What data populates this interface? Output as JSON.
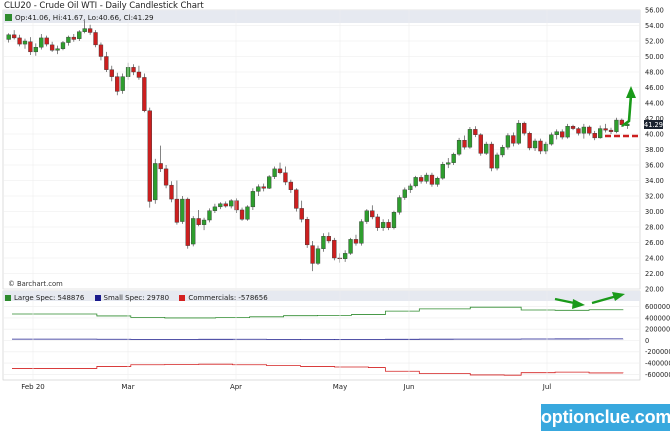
{
  "title": "CLU20 - Crude Oil WTI - Daily Candlestick Chart",
  "ohlc_text": "Op:41.06, Hi:41.67, Lo:40.66, Cl:41.29",
  "credit": "© Barchart.com",
  "last_price_label": "41.29",
  "brand": "optionclue.com",
  "cot_legend": [
    {
      "label": "Large Spec: 548876",
      "color": "#2e8b2e"
    },
    {
      "label": "Small Spec: 29780",
      "color": "#1a1a8c"
    },
    {
      "label": "Commercials: -578656",
      "color": "#d42020"
    }
  ],
  "colors": {
    "up": "#2e9e2e",
    "down": "#cc1f1f",
    "accent": "#1a9a1a",
    "dash": "#cc1f1f"
  },
  "chart_data": [
    {
      "type": "candlestick",
      "title": "CLU20 - Crude Oil WTI - Daily Candlestick Chart",
      "ylim": [
        20,
        56
      ],
      "yticks": [
        "20.00",
        "22.00",
        "24.00",
        "26.00",
        "28.00",
        "30.00",
        "32.00",
        "34.00",
        "36.00",
        "38.00",
        "40.00",
        "42.00",
        "44.00",
        "46.00",
        "48.00",
        "50.00",
        "52.00",
        "54.00",
        "56.00"
      ],
      "xticks": [
        "Feb 20",
        "Mar",
        "Apr",
        "May",
        "Jun",
        "Jul"
      ],
      "series": [
        {
          "values": [
            [
              52.2,
              53.0,
              51.8,
              52.8
            ],
            [
              52.8,
              53.4,
              52.2,
              52.4
            ],
            [
              52.4,
              52.8,
              51.3,
              51.6
            ],
            [
              51.6,
              52.3,
              51.0,
              52.0
            ],
            [
              51.9,
              52.5,
              50.2,
              50.6
            ],
            [
              50.6,
              51.7,
              50.1,
              51.2
            ],
            [
              51.2,
              52.9,
              50.9,
              52.4
            ],
            [
              52.4,
              52.7,
              51.3,
              51.6
            ],
            [
              51.5,
              51.9,
              50.6,
              50.8
            ],
            [
              50.8,
              51.4,
              50.3,
              51.0
            ],
            [
              51.0,
              52.0,
              50.8,
              51.8
            ],
            [
              51.8,
              52.7,
              51.4,
              52.5
            ],
            [
              52.5,
              52.9,
              51.9,
              52.2
            ],
            [
              52.3,
              53.4,
              52.0,
              53.2
            ],
            [
              53.2,
              54.6,
              53.0,
              53.6
            ],
            [
              53.6,
              54.1,
              52.8,
              53.1
            ],
            [
              53.1,
              53.4,
              51.2,
              51.5
            ],
            [
              51.5,
              51.8,
              49.5,
              50.0
            ],
            [
              50.0,
              50.6,
              48.0,
              48.3
            ],
            [
              48.3,
              48.8,
              46.8,
              47.4
            ],
            [
              47.4,
              47.9,
              45.0,
              45.5
            ],
            [
              45.6,
              47.8,
              45.2,
              47.4
            ],
            [
              47.4,
              49.2,
              47.0,
              48.6
            ],
            [
              48.6,
              49.0,
              47.6,
              48.0
            ],
            [
              48.0,
              48.8,
              47.0,
              47.3
            ],
            [
              47.3,
              47.8,
              42.8,
              43.0
            ],
            [
              43.0,
              43.4,
              30.5,
              31.3
            ],
            [
              31.5,
              36.8,
              31.0,
              36.2
            ],
            [
              36.2,
              38.5,
              35.1,
              35.5
            ],
            [
              35.5,
              36.0,
              33.0,
              33.4
            ],
            [
              33.4,
              33.9,
              31.2,
              31.6
            ],
            [
              31.6,
              34.0,
              28.3,
              28.6
            ],
            [
              28.7,
              32.0,
              28.4,
              31.6
            ],
            [
              31.6,
              31.8,
              25.2,
              25.6
            ],
            [
              25.8,
              29.4,
              25.5,
              29.1
            ],
            [
              29.1,
              30.2,
              28.1,
              28.3
            ],
            [
              28.3,
              29.2,
              27.6,
              28.9
            ],
            [
              28.9,
              30.4,
              28.6,
              30.1
            ],
            [
              30.1,
              31.0,
              29.8,
              30.6
            ],
            [
              30.6,
              31.2,
              30.3,
              31.0
            ],
            [
              31.0,
              31.3,
              30.5,
              30.7
            ],
            [
              30.7,
              31.6,
              30.4,
              31.4
            ],
            [
              31.4,
              31.7,
              29.8,
              30.2
            ],
            [
              30.2,
              30.5,
              28.8,
              29.0
            ],
            [
              29.0,
              30.8,
              28.8,
              30.6
            ],
            [
              30.6,
              33.0,
              30.2,
              32.6
            ],
            [
              32.6,
              33.5,
              32.0,
              33.2
            ],
            [
              33.2,
              33.6,
              32.6,
              33.0
            ],
            [
              33.0,
              34.7,
              32.9,
              34.5
            ],
            [
              34.5,
              35.8,
              34.2,
              35.5
            ],
            [
              35.5,
              36.3,
              34.8,
              35.0
            ],
            [
              35.0,
              35.8,
              33.4,
              33.8
            ],
            [
              33.8,
              34.1,
              32.4,
              32.8
            ],
            [
              32.8,
              33.0,
              30.0,
              30.4
            ],
            [
              30.4,
              31.4,
              28.6,
              29.0
            ],
            [
              29.0,
              29.3,
              25.3,
              25.7
            ],
            [
              25.6,
              26.2,
              22.3,
              23.3
            ],
            [
              23.3,
              25.6,
              23.1,
              25.2
            ],
            [
              25.2,
              27.2,
              24.8,
              26.8
            ],
            [
              26.8,
              27.3,
              25.9,
              26.2
            ],
            [
              26.3,
              26.6,
              23.7,
              24.0
            ],
            [
              24.0,
              24.6,
              23.4,
              23.9
            ],
            [
              23.9,
              25.0,
              23.5,
              24.6
            ],
            [
              24.6,
              26.6,
              24.4,
              26.4
            ],
            [
              26.4,
              27.0,
              25.6,
              25.9
            ],
            [
              25.9,
              29.0,
              25.6,
              28.7
            ],
            [
              28.7,
              30.3,
              28.4,
              30.1
            ],
            [
              30.1,
              30.8,
              29.0,
              29.3
            ],
            [
              29.3,
              29.7,
              27.5,
              27.9
            ],
            [
              27.9,
              29.0,
              27.5,
              28.6
            ],
            [
              28.6,
              29.0,
              27.6,
              27.9
            ],
            [
              27.9,
              30.1,
              27.7,
              29.9
            ],
            [
              29.9,
              32.1,
              29.6,
              31.8
            ],
            [
              31.8,
              33.1,
              31.5,
              32.8
            ],
            [
              32.8,
              33.6,
              32.4,
              33.3
            ],
            [
              33.3,
              34.6,
              33.1,
              34.4
            ],
            [
              34.4,
              34.7,
              33.6,
              33.9
            ],
            [
              33.9,
              35.0,
              33.6,
              34.7
            ],
            [
              34.7,
              35.0,
              33.2,
              33.5
            ],
            [
              33.5,
              34.5,
              33.2,
              34.3
            ],
            [
              34.3,
              36.4,
              34.1,
              36.1
            ],
            [
              36.1,
              36.9,
              35.6,
              36.3
            ],
            [
              36.3,
              37.6,
              36.0,
              37.4
            ],
            [
              37.4,
              39.5,
              37.2,
              39.2
            ],
            [
              39.2,
              39.8,
              38.0,
              38.3
            ],
            [
              38.3,
              40.9,
              38.1,
              40.6
            ],
            [
              40.6,
              41.0,
              39.6,
              39.9
            ],
            [
              39.9,
              40.1,
              37.2,
              37.5
            ],
            [
              37.5,
              39.0,
              37.3,
              38.7
            ],
            [
              38.7,
              39.0,
              35.2,
              35.6
            ],
            [
              35.6,
              37.6,
              35.3,
              37.3
            ],
            [
              37.3,
              38.6,
              37.0,
              38.3
            ],
            [
              38.3,
              40.1,
              38.0,
              39.8
            ],
            [
              39.8,
              40.2,
              38.4,
              38.8
            ],
            [
              38.8,
              41.8,
              38.6,
              41.4
            ],
            [
              41.4,
              41.6,
              39.8,
              40.1
            ],
            [
              40.1,
              40.3,
              37.9,
              38.2
            ],
            [
              38.2,
              39.4,
              37.8,
              39.1
            ],
            [
              39.1,
              39.4,
              37.4,
              37.8
            ],
            [
              37.8,
              39.0,
              37.4,
              38.7
            ],
            [
              38.7,
              40.2,
              38.5,
              39.9
            ],
            [
              39.9,
              40.6,
              39.3,
              40.3
            ],
            [
              40.3,
              40.6,
              39.3,
              39.6
            ],
            [
              39.6,
              41.3,
              39.4,
              41.0
            ],
            [
              41.0,
              41.2,
              40.5,
              40.7
            ],
            [
              40.7,
              40.9,
              39.8,
              40.1
            ],
            [
              40.1,
              41.3,
              39.4,
              40.9
            ],
            [
              40.9,
              41.1,
              39.8,
              40.1
            ],
            [
              40.1,
              40.4,
              39.2,
              39.5
            ],
            [
              39.5,
              41.1,
              39.4,
              40.7
            ],
            [
              40.7,
              41.3,
              40.2,
              40.5
            ],
            [
              40.5,
              40.8,
              40.0,
              40.3
            ],
            [
              40.3,
              42.1,
              40.1,
              41.8
            ],
            [
              41.8,
              42.0,
              40.9,
              41.2
            ],
            [
              41.06,
              41.67,
              40.66,
              41.29
            ]
          ]
        }
      ]
    },
    {
      "type": "line",
      "title": "COT",
      "ylim": [
        -700000,
        700000
      ],
      "yticks": [
        "600000",
        "400000",
        "200000",
        "0",
        "-200000",
        "-400000",
        "-600000"
      ],
      "series": [
        {
          "name": "Large Spec: 548876",
          "values": [
            470000,
            470000,
            470000,
            470000,
            470000,
            435000,
            435000,
            410000,
            410000,
            400000,
            400000,
            400000,
            405000,
            405000,
            420000,
            420000,
            440000,
            440000,
            445000,
            445000,
            460000,
            460000,
            520000,
            520000,
            560000,
            560000,
            560000,
            590000,
            590000,
            590000,
            540000,
            540000,
            535000,
            535000,
            545000,
            545000,
            548876
          ]
        },
        {
          "name": "Small Spec: 29780",
          "values": [
            25000,
            25000,
            25000,
            25000,
            25000,
            22000,
            22000,
            20000,
            20000,
            20000,
            20000,
            21000,
            21000,
            22000,
            22000,
            20000,
            20000,
            18000,
            18000,
            20000,
            20000,
            20000,
            21000,
            21000,
            23000,
            23000,
            24000,
            24000,
            25000,
            25000,
            27000,
            27000,
            28000,
            28000,
            29000,
            29000,
            29780
          ]
        },
        {
          "name": "Commercials: -578656",
          "values": [
            -495000,
            -495000,
            -495000,
            -495000,
            -495000,
            -460000,
            -460000,
            -430000,
            -430000,
            -425000,
            -425000,
            -420000,
            -420000,
            -430000,
            -430000,
            -445000,
            -445000,
            -460000,
            -460000,
            -470000,
            -470000,
            -480000,
            -545000,
            -545000,
            -585000,
            -585000,
            -585000,
            -610000,
            -610000,
            -615000,
            -570000,
            -570000,
            -560000,
            -560000,
            -575000,
            -575000,
            -578656
          ]
        }
      ]
    }
  ]
}
